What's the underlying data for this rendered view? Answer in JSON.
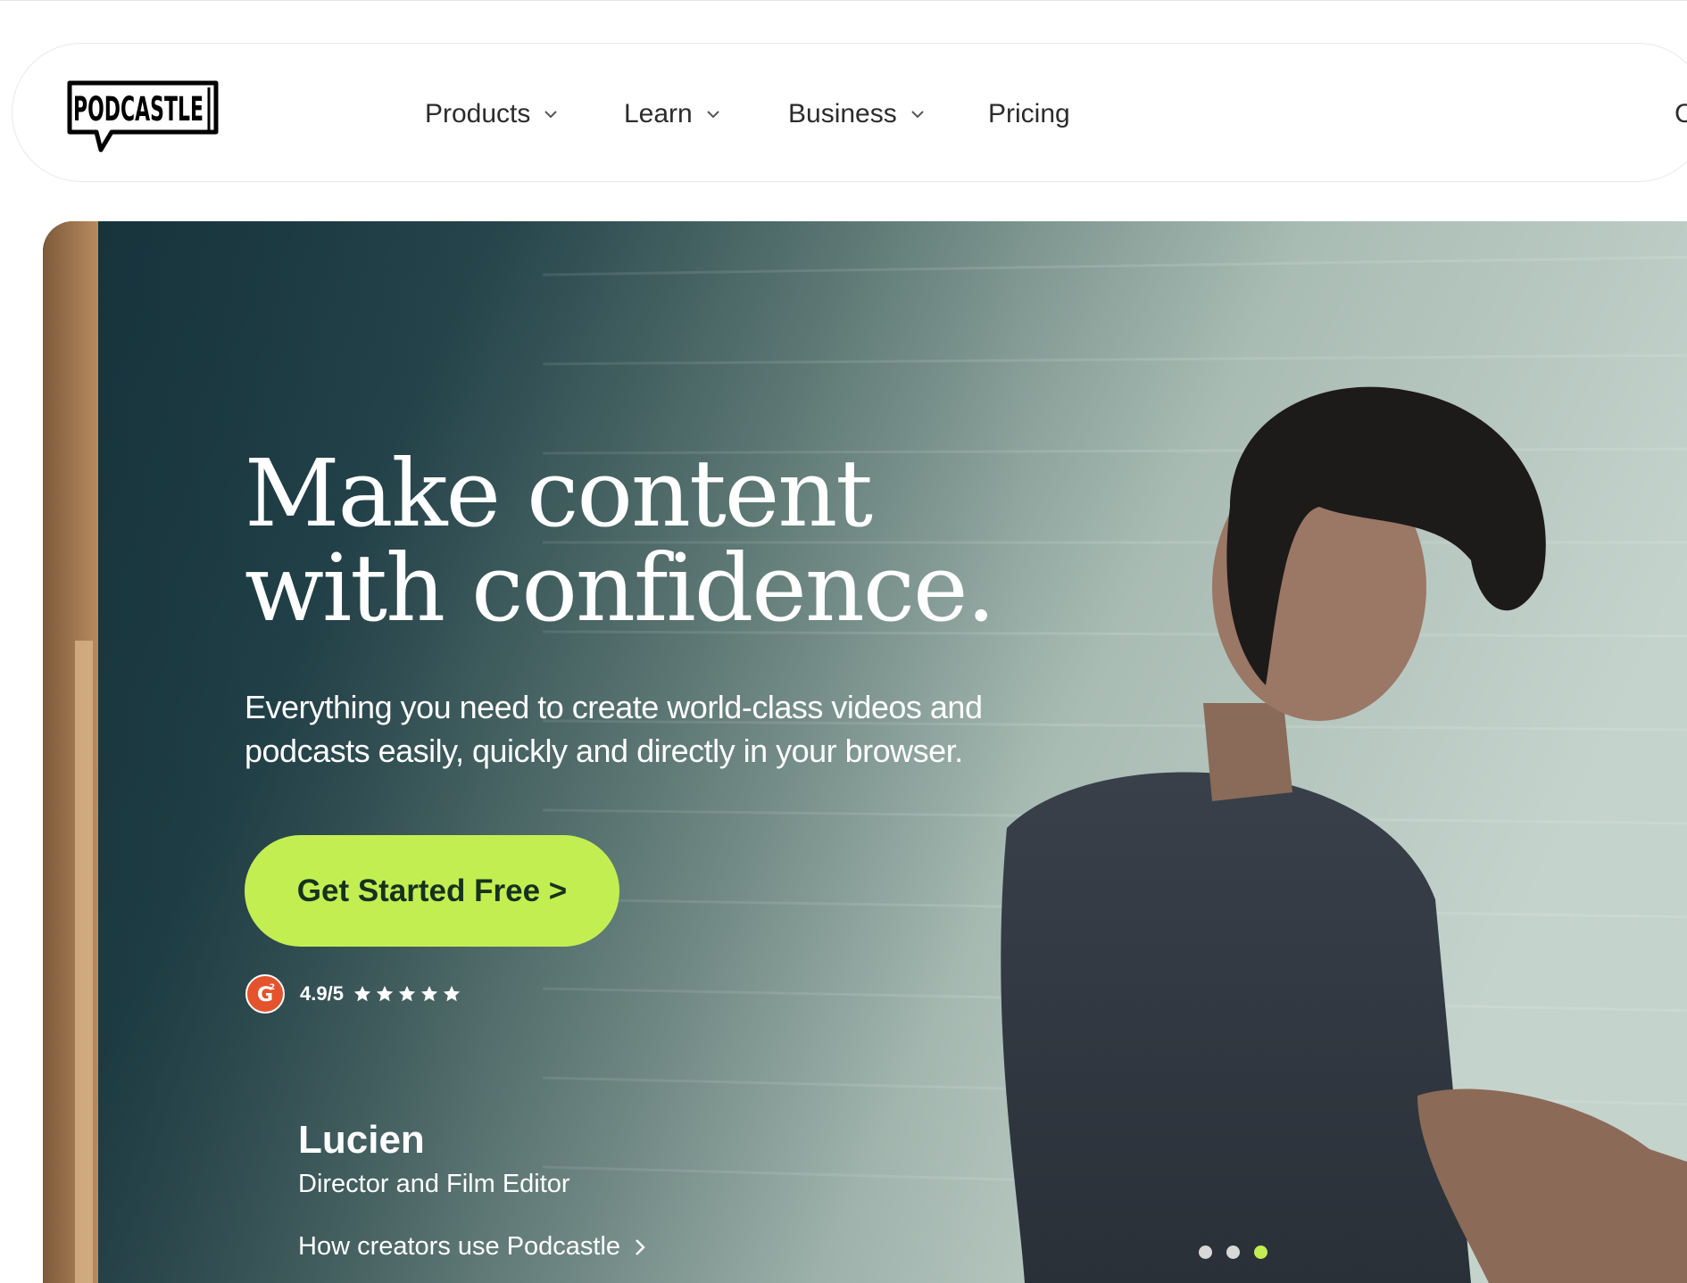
{
  "brand": {
    "logo_text": "PODCASTLE"
  },
  "nav": {
    "items": [
      {
        "label": "Products",
        "has_dropdown": true
      },
      {
        "label": "Learn",
        "has_dropdown": true
      },
      {
        "label": "Business",
        "has_dropdown": true
      },
      {
        "label": "Pricing",
        "has_dropdown": false
      }
    ],
    "cut_off_item": "C"
  },
  "hero": {
    "headline_line1": "Make content",
    "headline_line2": "with confidence.",
    "subhead_line1": "Everything you need to create world-class videos and",
    "subhead_line2": "podcasts easily, quickly and directly in your browser.",
    "cta_label": "Get Started Free >",
    "rating": {
      "value": "4.9/5",
      "stars": 5,
      "badge": "g2-icon"
    },
    "creator": {
      "name": "Lucien",
      "role": "Director and Film Editor",
      "link": "How creators use Podcastle"
    },
    "carousel": {
      "slide_count": 3,
      "active_slide": 3
    }
  },
  "colors": {
    "accent": "#c3ee52",
    "cta_text": "#16321f",
    "nav_text": "#2c2c2c",
    "g2_red": "#e4532d"
  }
}
